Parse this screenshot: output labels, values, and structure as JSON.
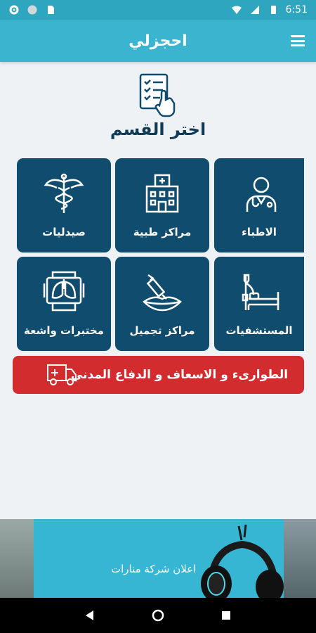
{
  "status_bar": {
    "time": "6:51",
    "icons_left": [
      "gear-icon",
      "circle-icon",
      "sim-icon"
    ],
    "icons_right": [
      "wifi-icon",
      "signal-icon",
      "battery-icon"
    ]
  },
  "app_bar": {
    "title": "احجزلي",
    "menu_icon": "hamburger-menu-icon"
  },
  "section": {
    "title": "اختر القسم",
    "icon": "checklist-pointer-icon"
  },
  "tiles": [
    {
      "label": "الاطباء",
      "icon": "doctor-icon"
    },
    {
      "label": "مراكز طبية",
      "icon": "hospital-building-icon"
    },
    {
      "label": "صيدليات",
      "icon": "caduceus-icon"
    },
    {
      "label": "المستشفيات",
      "icon": "hospital-bed-icon"
    },
    {
      "label": "مراكز تجميل",
      "icon": "lips-syringe-icon"
    },
    {
      "label": "مختبرات واشعة",
      "icon": "xray-lungs-icon"
    }
  ],
  "emergency": {
    "label": "الطوارىء و الاسعاف و الدفاع المدني",
    "icon": "ambulance-icon"
  },
  "ad": {
    "text": "اعلان شركة منارات"
  },
  "colors": {
    "primary": "#3bb4cf",
    "tile": "#0f4c6e",
    "emergency": "#d32c2f",
    "title": "#0f3b57"
  }
}
